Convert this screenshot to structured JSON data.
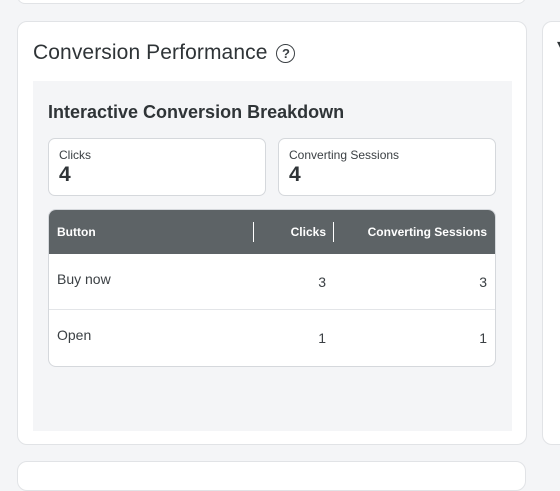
{
  "card": {
    "title": "Conversion Performance"
  },
  "panel": {
    "title": "Interactive Conversion Breakdown",
    "stats": {
      "clicks": {
        "label": "Clicks",
        "value": "4"
      },
      "sessions": {
        "label": "Converting Sessions",
        "value": "4"
      }
    },
    "table": {
      "headers": [
        "Button",
        "Clicks",
        "Converting Sessions"
      ],
      "rows": [
        [
          "Buy now",
          "3",
          "3"
        ],
        [
          "Open",
          "1",
          "1"
        ]
      ]
    }
  },
  "colors": {
    "header_bg": "#5d6366",
    "panel_bg": "#f4f5f7",
    "card_bg": "#ffffff"
  },
  "icons": {
    "help": "help-circle-icon"
  }
}
